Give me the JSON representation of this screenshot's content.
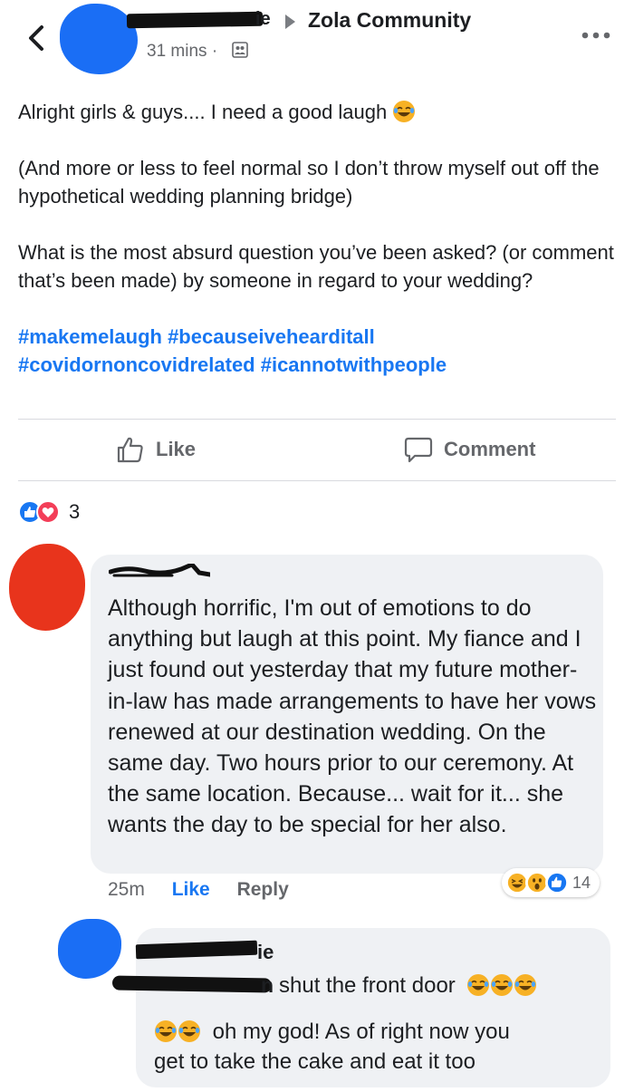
{
  "header": {
    "back_icon": "chevron-left-icon",
    "author_name_visible_tail": "ie",
    "group_name": "Zola Community",
    "time": "31 mins",
    "separator": "·",
    "audience_icon": "group-audience-icon",
    "more_icon": "more-horizontal-icon"
  },
  "post": {
    "paragraphs": [
      "Alright girls & guys.... I need a good laugh",
      "(And more or less to feel normal so I don’t throw myself out off the hypothetical wedding planning bridge)",
      "What is the most absurd question you’ve been asked? (or comment that’s been made)  by someone in regard to your wedding?"
    ],
    "hashtags_line1": "#makemelaugh #becauseivehearditall",
    "hashtags_line2": "#covidornoncovidrelated #icannotwithpeople"
  },
  "actions": {
    "like_label": "Like",
    "comment_label": "Comment"
  },
  "reactions": {
    "count": "3",
    "types": [
      "like",
      "love"
    ]
  },
  "comments": [
    {
      "text": "Although horrific, I'm out of emotions to do anything but laugh at this point. My fiance and I just found out yesterday that my future mother-in-law has made arrangements to have her vows renewed at our destination wedding. On the same day. Two hours prior to our ceremony. At the same location. Because... wait for it... she wants the day to be special for her also.",
      "time": "25m",
      "like_label": "Like",
      "reply_label": "Reply",
      "reaction_count": "14",
      "reaction_types": [
        "haha",
        "wow",
        "like"
      ]
    },
    {
      "name_visible_tail": "ie",
      "mention_visible_tail": "n",
      "line1": "shut the front door",
      "line2": "oh my god! As of right now you",
      "line3": "get to take the cake and eat it too"
    }
  ],
  "colors": {
    "link_blue": "#1877f2",
    "secondary_text": "#65676b",
    "bubble_bg": "#eff1f4",
    "love_red": "#f33e58",
    "haha_yellow": "#f7b125"
  }
}
